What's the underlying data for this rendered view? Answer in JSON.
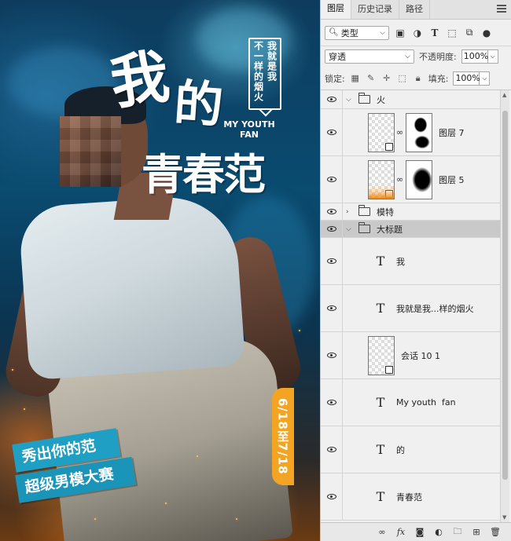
{
  "poster": {
    "title_wo": "我",
    "title_de": "的",
    "title_qcf": "青春范",
    "subtitle_line1": "MY YOUTH",
    "subtitle_line2": "FAN",
    "bubble_col1": "我就是我",
    "bubble_col2": "不一样的烟火",
    "banner1": "秀出你的范",
    "banner2": "超级男模大赛",
    "date": "6/18至7/18"
  },
  "panel": {
    "tabs": [
      "图层",
      "历史记录",
      "路径"
    ],
    "filter": {
      "select_value": "类型",
      "icons": [
        "image-filter-icon",
        "adjustment-filter-icon",
        "type-filter-icon",
        "shape-filter-icon",
        "smart-object-filter-icon",
        "filter-toggle-icon"
      ]
    },
    "blend": {
      "mode": "穿透",
      "opacity_label": "不透明度:",
      "opacity_value": "100%"
    },
    "lock": {
      "label": "锁定:",
      "fill_label": "填充:",
      "fill_value": "100%"
    },
    "layers": [
      {
        "type": "group",
        "name": "火",
        "expanded": true
      },
      {
        "type": "smart",
        "name": "图层 7"
      },
      {
        "type": "smart",
        "name": "图层 5"
      },
      {
        "type": "group",
        "name": "模特",
        "expanded": false
      },
      {
        "type": "group",
        "name": "大标题",
        "expanded": true,
        "selected": true
      },
      {
        "type": "text",
        "name": "我"
      },
      {
        "type": "text",
        "name": "我就是我...样的烟火"
      },
      {
        "type": "shape",
        "name": "会话 10 1"
      },
      {
        "type": "text",
        "name": "My youth  fan"
      },
      {
        "type": "text",
        "name": "的"
      },
      {
        "type": "text",
        "name": "青春范"
      }
    ],
    "bottom_fx": "fx"
  },
  "colors": {
    "banner_blue": "#1f9fc4",
    "date_orange": "#f3a423",
    "panel_bg": "#f0f0f0",
    "selected_row": "#c9c9c9"
  }
}
